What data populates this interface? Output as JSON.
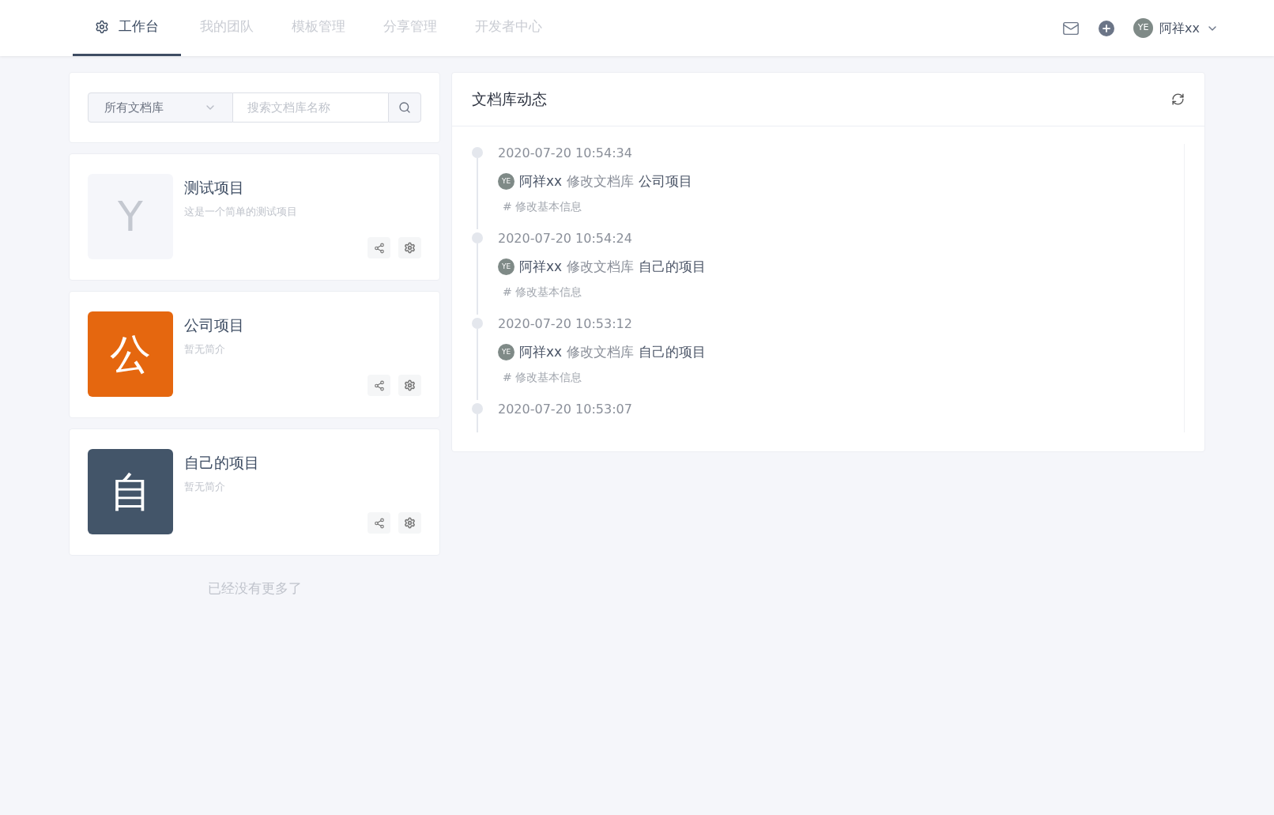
{
  "nav": {
    "tabs": [
      {
        "label": "工作台",
        "selected": true
      },
      {
        "label": "我的团队",
        "selected": false
      },
      {
        "label": "模板管理",
        "selected": false
      },
      {
        "label": "分享管理",
        "selected": false
      },
      {
        "label": "开发者中心",
        "selected": false
      }
    ],
    "user": {
      "avatar": "YE",
      "name": "阿祥xx"
    }
  },
  "filter": {
    "select": "所有文档库",
    "search": {
      "placeholder": "搜索文档库名称"
    }
  },
  "projects": [
    {
      "letter": "Y",
      "kind": "plain",
      "color": "#f5f6fa",
      "name": "测试项目",
      "desc": "这是一个简单的测试项目"
    },
    {
      "letter": "公",
      "kind": "colored",
      "color": "#e5670f",
      "name": "公司项目",
      "desc": "暂无简介"
    },
    {
      "letter": "自",
      "kind": "colored",
      "color": "#435569",
      "name": "自己的项目",
      "desc": "暂无简介"
    }
  ],
  "end_note": "已经没有更多了",
  "activity": {
    "title": "文档库动态",
    "items": [
      {
        "time": "2020-07-20 10:54:34",
        "avatar": "YE",
        "user": "阿祥xx",
        "action": "修改文档库",
        "target": "公司项目",
        "detail": "# 修改基本信息"
      },
      {
        "time": "2020-07-20 10:54:24",
        "avatar": "YE",
        "user": "阿祥xx",
        "action": "修改文档库",
        "target": "自己的项目",
        "detail": "# 修改基本信息"
      },
      {
        "time": "2020-07-20 10:53:12",
        "avatar": "YE",
        "user": "阿祥xx",
        "action": "修改文档库",
        "target": "自己的项目",
        "detail": "# 修改基本信息"
      },
      {
        "time": "2020-07-20 10:53:07"
      }
    ]
  }
}
